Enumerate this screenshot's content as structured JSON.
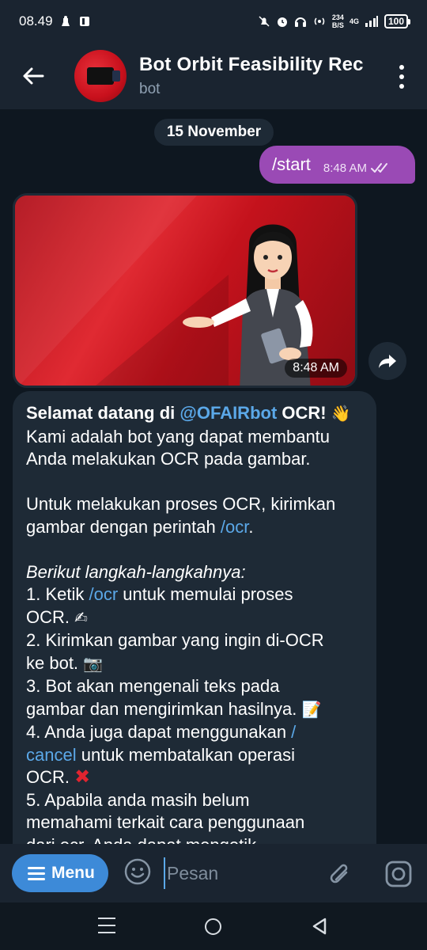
{
  "status_bar": {
    "time": "08.49",
    "speed_value": "234",
    "speed_unit": "B/S",
    "network": "4G",
    "battery": "100"
  },
  "header": {
    "title": "Bot Orbit Feasibility Rec",
    "subtitle": "bot"
  },
  "chat": {
    "date": "15 November",
    "outgoing": {
      "text": "/start",
      "time": "8:48 AM"
    },
    "image": {
      "time": "8:48 AM"
    },
    "message": {
      "l1_a": "Selamat datang di ",
      "l1_link": "@OFAIRbot",
      "l1_b": " OCR! ",
      "l1_emoji": "👋",
      "l2": "Kami adalah bot yang dapat membantu",
      "l3": "Anda melakukan OCR pada gambar.",
      "l5": "Untuk melakukan proses OCR, kirimkan",
      "l6_a": "gambar dengan perintah ",
      "l6_link": "/ocr",
      "l6_b": ".",
      "l8": "Berikut langkah-langkahnya:",
      "l9_a": "1. Ketik ",
      "l9_link": "/ocr",
      "l9_b": " untuk memulai proses",
      "l10": "OCR. ",
      "l10_emoji": "✍",
      "l11": "2. Kirimkan gambar yang ingin di-OCR",
      "l12": "ke bot. ",
      "l12_emoji": "📷",
      "l13": "3. Bot akan mengenali teks pada",
      "l14": "gambar dan mengirimkan hasilnya. ",
      "l14_emoji": "📝",
      "l15_a": "4. Anda juga dapat menggunakan ",
      "l15_link": "/",
      "l16_link": "cancel",
      "l16_b": " untuk membatalkan operasi",
      "l17": "OCR. ",
      "l17_emoji": "✖",
      "l18": "5. Apabila anda masih belum",
      "l19": "memahami terkait cara penggunaan",
      "l20": "dari ocr. Anda dapat mengetik"
    }
  },
  "input_bar": {
    "menu_label": "Menu",
    "placeholder": "Pesan"
  },
  "colors": {
    "accent": "#3d8ad8",
    "outgoing_bubble": "#9a4ab5",
    "link": "#5ba8e8",
    "background": "#0e1720"
  }
}
